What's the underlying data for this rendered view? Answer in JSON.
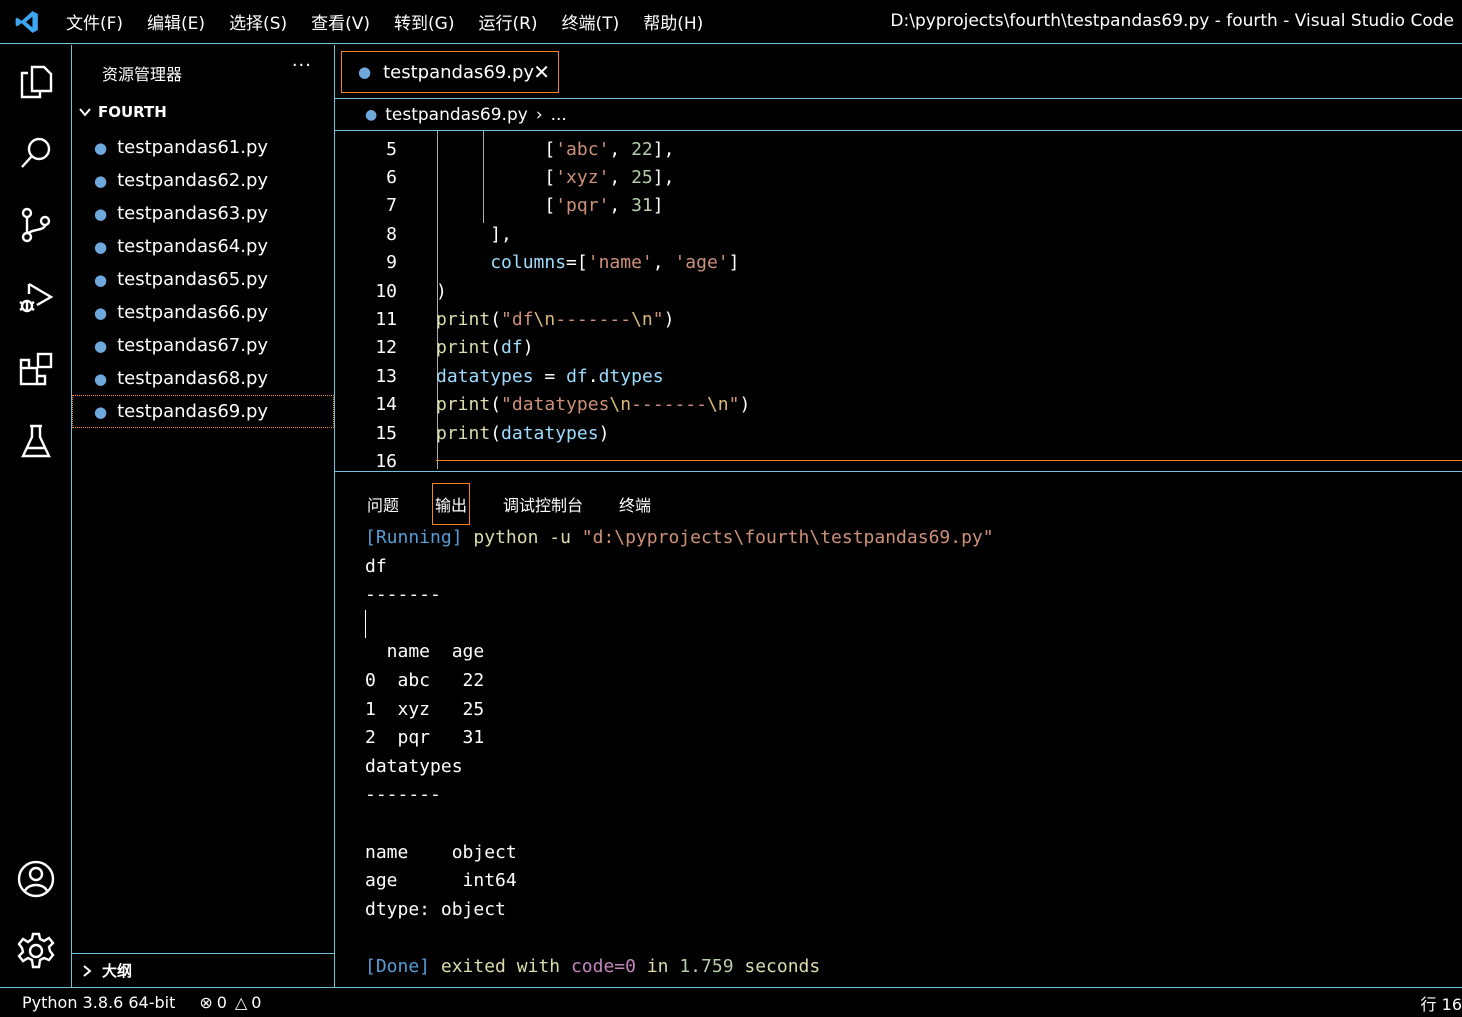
{
  "titlebar": {
    "menu": [
      "文件(F)",
      "编辑(E)",
      "选择(S)",
      "查看(V)",
      "转到(G)",
      "运行(R)",
      "终端(T)",
      "帮助(H)"
    ],
    "title": "D:\\pyprojects\\fourth\\testpandas69.py - fourth - Visual Studio Code"
  },
  "activity_icons": [
    "explorer-icon",
    "search-icon",
    "source-control-icon",
    "run-debug-icon",
    "extensions-icon",
    "testing-icon",
    "account-icon",
    "settings-gear-icon"
  ],
  "sidebar": {
    "title": "资源管理器",
    "more": "···",
    "folder": "FOURTH",
    "files": [
      "testpandas61.py",
      "testpandas62.py",
      "testpandas63.py",
      "testpandas64.py",
      "testpandas65.py",
      "testpandas66.py",
      "testpandas67.py",
      "testpandas68.py",
      "testpandas69.py"
    ],
    "outline": "大纲"
  },
  "editor": {
    "tab": "testpandas69.py",
    "close": "✕",
    "breadcrumb_file": "testpandas69.py",
    "breadcrumb_sep": "›",
    "breadcrumb_more": "...",
    "line_numbers": [
      "5",
      "6",
      "7",
      "8",
      "9",
      "10",
      "11",
      "12",
      "13",
      "14",
      "15",
      "16"
    ]
  },
  "panel": {
    "tabs": [
      "问题",
      "输出",
      "调试控制台",
      "终端"
    ],
    "output": {
      "run_tag": "[Running]",
      "run_cmd": "python -u",
      "run_path": "\"d:\\pyprojects\\fourth\\testpandas69.py\"",
      "lines": [
        "df",
        "-------",
        "",
        "  name  age",
        "0  abc   22",
        "1  xyz   25",
        "2  pqr   31",
        "datatypes",
        "-------",
        "",
        "name    object",
        "age      int64",
        "dtype: object",
        ""
      ],
      "done_tag": "[Done]",
      "done_a": "exited with",
      "done_code": "code=0",
      "done_in": "in",
      "done_time": "1.759",
      "done_sec": "seconds"
    }
  },
  "statusbar": {
    "python": "Python 3.8.6 64-bit",
    "errors": "0",
    "warnings": "0",
    "position": "行 16"
  }
}
